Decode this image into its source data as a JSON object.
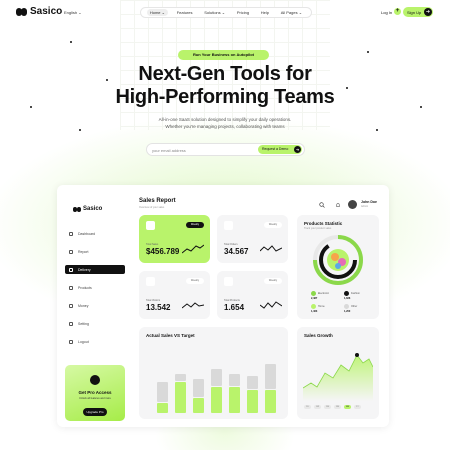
{
  "brand": {
    "name": "Sasico"
  },
  "header": {
    "language": "English ⌄",
    "nav": [
      {
        "label": "Home ⌄",
        "active": true
      },
      {
        "label": "Features",
        "active": false
      },
      {
        "label": "Solutions ⌄",
        "active": false
      },
      {
        "label": "Pricing",
        "active": false
      },
      {
        "label": "Help",
        "active": false
      },
      {
        "label": "All Pages ⌄",
        "active": false
      }
    ],
    "login": "Log In",
    "signup": "Sign Up"
  },
  "hero": {
    "badge": "Run Your Business on Autopilot",
    "title_line1": "Next-Gen Tools for",
    "title_line2": "High-Performing Teams",
    "subtitle_line1": "All-in-one SaaS solution designed to simplify your daily operations.",
    "subtitle_line2": "Whether you're managing projects, collaborating with teams",
    "email_placeholder": "your email address",
    "cta": "Request a Demo"
  },
  "dashboard": {
    "sidebar": {
      "brand": "Sasico",
      "items": [
        {
          "label": "Dashboard",
          "active": false
        },
        {
          "label": "Report",
          "active": false
        },
        {
          "label": "Delivery",
          "active": true
        },
        {
          "label": "Products",
          "active": false
        },
        {
          "label": "Money",
          "active": false
        },
        {
          "label": "Setting",
          "active": false
        },
        {
          "label": "Logout",
          "active": false
        }
      ],
      "pro": {
        "title": "Get Pro Access",
        "subtitle": "Unlock all features and more",
        "button": "Upgrade Pro"
      }
    },
    "title": "Sales Report",
    "title_sub": "Overview of your sales",
    "user": {
      "name": "John Doe",
      "role": "Admin"
    },
    "stats": [
      {
        "label": "Total Sales",
        "value": "$456.789",
        "pill": "Weekly",
        "highlight": true
      },
      {
        "label": "Total Orders",
        "value": "34.567",
        "pill": "Weekly",
        "highlight": false
      },
      {
        "label": "Total Visitors",
        "value": "13.542",
        "pill": "Weekly",
        "highlight": false
      },
      {
        "label": "Total Products",
        "value": "1.654",
        "pill": "Weekly",
        "highlight": false
      }
    ],
    "products_statistic": {
      "title": "Products Statistic",
      "subtitle": "Track your product sales",
      "legend": [
        {
          "name": "Electronic",
          "value": "2,487",
          "color": "#8bd84a"
        },
        {
          "name": "Fashion",
          "value": "1,828",
          "color": "#111111"
        },
        {
          "name": "Home",
          "value": "1,463",
          "color": "#b9f36b"
        },
        {
          "name": "Other",
          "value": "1,200",
          "color": "#d9d9d9"
        }
      ]
    },
    "actual_vs_target": {
      "title": "Actual Sales VS Target",
      "actual": [
        0.3,
        0.95,
        0.45,
        0.8,
        0.8,
        0.7,
        0.7
      ],
      "target": [
        0.6,
        0.2,
        0.55,
        0.5,
        0.35,
        0.4,
        0.75
      ]
    },
    "sales_growth": {
      "title": "Sales Growth",
      "periods": [
        "1D",
        "1W",
        "1M",
        "3M",
        "6M",
        "1Y"
      ],
      "active_period": "6M"
    }
  }
}
